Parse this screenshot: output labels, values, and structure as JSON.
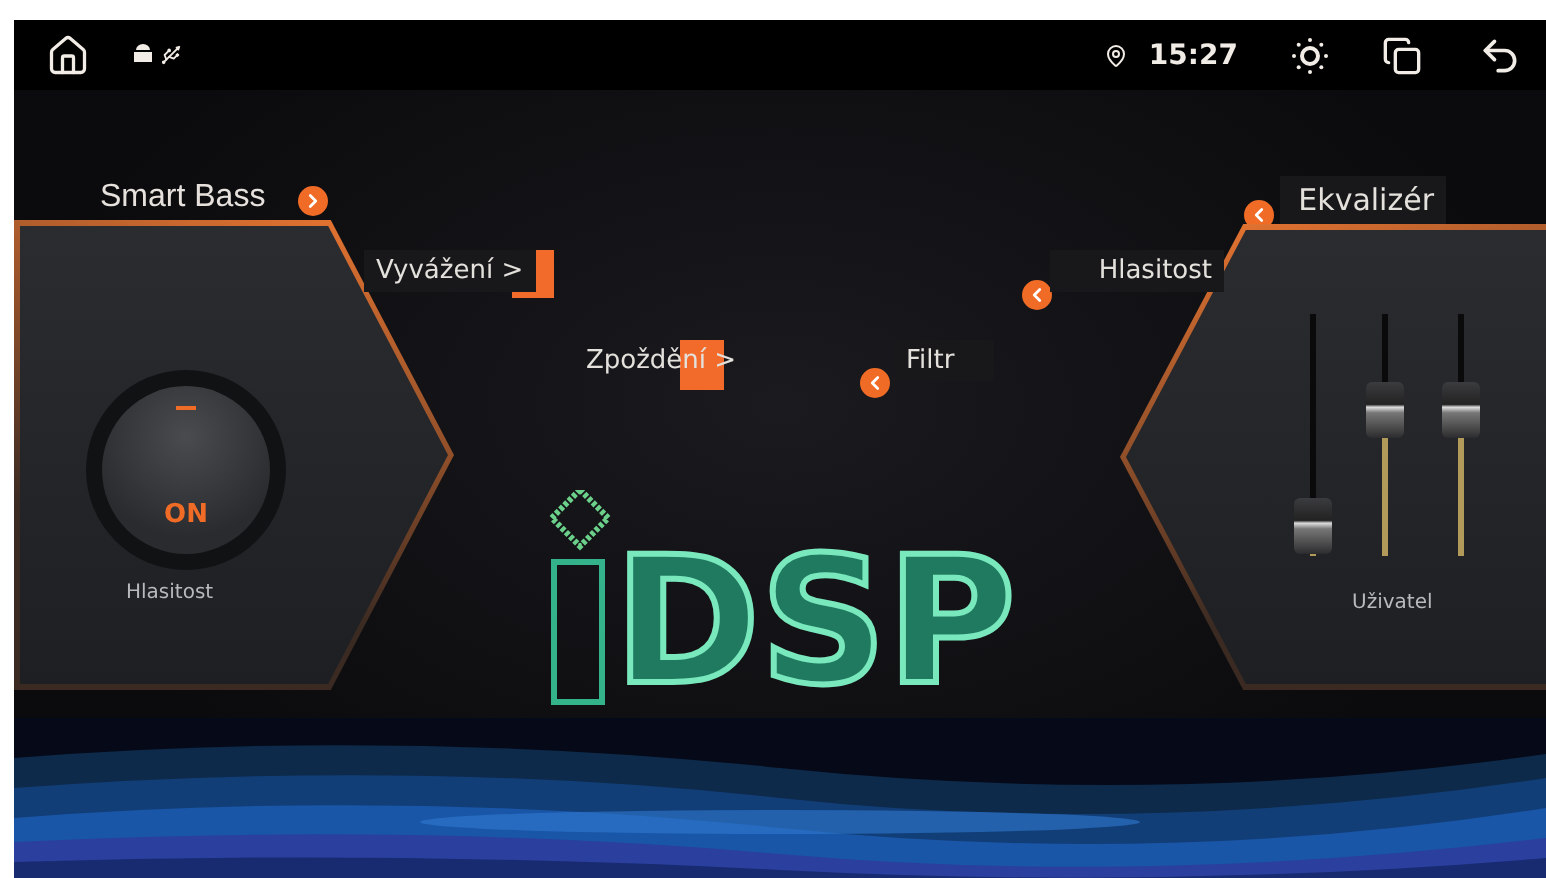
{
  "status_bar": {
    "time": "15:27"
  },
  "smart_bass": {
    "label": "Smart Bass",
    "knob_label": "ON",
    "caption": "Hlasitost"
  },
  "menu_left": [
    {
      "label": "Vyvážení >"
    },
    {
      "label": "Zpoždění >"
    }
  ],
  "menu_right": [
    {
      "label": "Filtr"
    },
    {
      "label": "Hlasitost"
    },
    {
      "label": "Ekvalizér"
    }
  ],
  "equalizer": {
    "caption": "Uživatel",
    "sliders": [
      {
        "level": 0.12
      },
      {
        "level": 0.6
      },
      {
        "level": 0.6
      }
    ]
  },
  "logo": {
    "text": "DSP"
  }
}
